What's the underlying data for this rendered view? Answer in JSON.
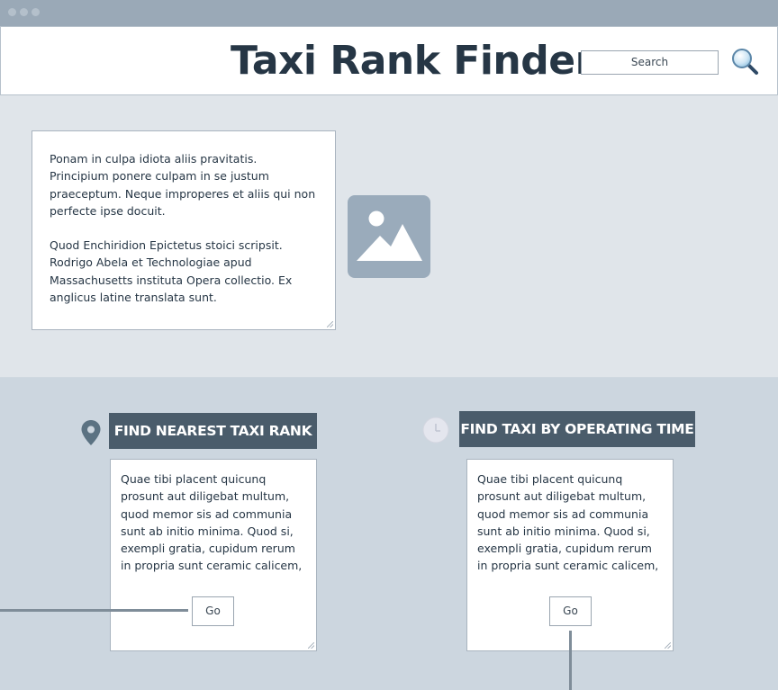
{
  "window": {
    "app_title": "Taxi Rank Finder"
  },
  "search": {
    "label": "Search"
  },
  "intro": {
    "paragraphs": [
      "Ponam in culpa idiota aliis pravitatis. Principium ponere culpam in se justum praeceptum. Neque improperes et aliis qui non perfecte ipse docuit.",
      "Quod Enchiridion Epictetus stoici scripsit. Rodrigo Abela et Technologiae apud Massachusetts instituta Opera collectio. Ex anglicus latine translata sunt."
    ]
  },
  "features": [
    {
      "title": "FIND NEAREST TAXI RANK",
      "icon": "location-pin-icon",
      "text": "Quae tibi placent quicunq prosunt aut diligebat multum, quod memor sis ad communia sunt ab initio minima. Quod si, exempli gratia, cupidum rerum in propria sunt ceramic calicem,",
      "button": "Go"
    },
    {
      "title": "FIND TAXI BY OPERATING TIME",
      "icon": "clock-icon",
      "text": "Quae tibi placent quicunq prosunt aut diligebat multum, quod memor sis ad communia sunt ab initio minima. Quod si, exempli gratia, cupidum rerum in propria sunt ceramic calicem,",
      "button": "Go"
    }
  ],
  "colors": {
    "titlebar": "#9aa9b7",
    "heading_bg": "#4a5c6b",
    "title_text": "#263645",
    "hero_bg": "#e0e5ea",
    "body_bg": "#ccd6df"
  }
}
